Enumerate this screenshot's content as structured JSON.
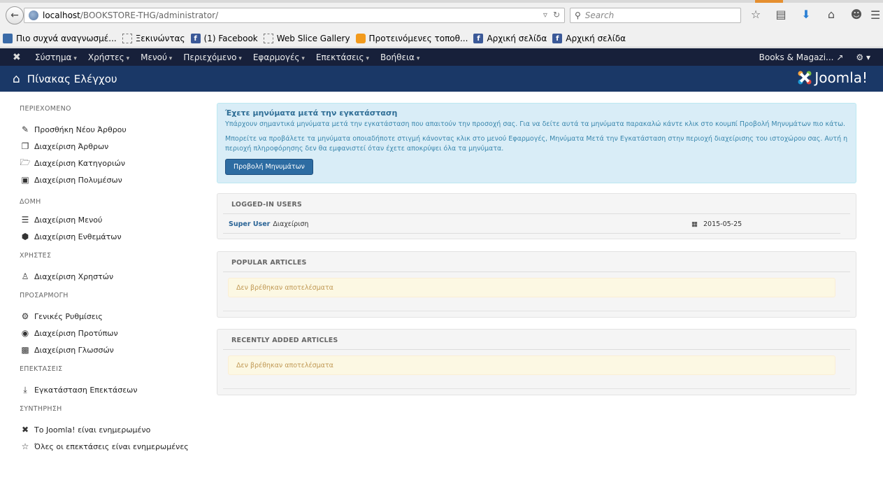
{
  "browser": {
    "url_host": "localhost",
    "url_path": "/BOOKSTORE-THG/administrator/",
    "search_placeholder": "Search",
    "bookmarks": [
      {
        "label": "Πιο συχνά αναγνωσμέ...",
        "icon": "folder-icon"
      },
      {
        "label": "Ξεκινώντας",
        "icon": "page-icon"
      },
      {
        "label": "(1) Facebook",
        "icon": "facebook-icon"
      },
      {
        "label": "Web Slice Gallery",
        "icon": "page-icon"
      },
      {
        "label": "Προτεινόμενες τοποθ...",
        "icon": "bulb-icon"
      },
      {
        "label": "Αρχική σελίδα",
        "icon": "facebook-icon"
      },
      {
        "label": "Αρχική σελίδα",
        "icon": "facebook-icon"
      }
    ]
  },
  "nav": {
    "menu": [
      "Σύστημα",
      "Χρήστες",
      "Μενού",
      "Περιεχόμενο",
      "Εφαρμογές",
      "Επεκτάσεις",
      "Βοήθεια"
    ],
    "site_link": "Books & Magazi..."
  },
  "header": {
    "title": "Πίνακας Ελέγχου",
    "brand": "Joomla!"
  },
  "sidebar": {
    "sections": [
      {
        "title": "ΠΕΡΙΕΧΟΜΕΝΟ",
        "items": [
          {
            "label": "Προσθήκη Νέου Άρθρου",
            "icon": "pencil-icon"
          },
          {
            "label": "Διαχείριση Άρθρων",
            "icon": "copy-icon"
          },
          {
            "label": "Διαχείριση Κατηγοριών",
            "icon": "folder-icon"
          },
          {
            "label": "Διαχείριση Πολυμέσων",
            "icon": "image-icon"
          }
        ]
      },
      {
        "title": "ΔΟΜΗ",
        "items": [
          {
            "label": "Διαχείριση Μενού",
            "icon": "list-icon"
          },
          {
            "label": "Διαχείριση Ενθεμάτων",
            "icon": "cube-icon"
          }
        ]
      },
      {
        "title": "ΧΡΗΣΤΕΣ",
        "items": [
          {
            "label": "Διαχείριση Χρηστών",
            "icon": "users-icon"
          }
        ]
      },
      {
        "title": "ΠΡΟΣΑΡΜΟΓΗ",
        "items": [
          {
            "label": "Γενικές Ρυθμίσεις",
            "icon": "gear-icon"
          },
          {
            "label": "Διαχείριση Προτύπων",
            "icon": "eye-icon"
          },
          {
            "label": "Διαχείριση Γλωσσών",
            "icon": "comments-icon"
          }
        ]
      },
      {
        "title": "ΕΠΕΚΤΑΣΕΙΣ",
        "items": [
          {
            "label": "Εγκατάσταση Επεκτάσεων",
            "icon": "download-icon"
          }
        ]
      },
      {
        "title": "ΣΥΝΤΗΡΗΣΗ",
        "items": [
          {
            "label": "Το Joomla! είναι ενημερωμένο",
            "icon": "joomla-icon"
          },
          {
            "label": "Όλες οι επεκτάσεις είναι ενημερωμένες",
            "icon": "star-icon"
          }
        ]
      }
    ]
  },
  "alert": {
    "title": "Έχετε μηνύματα μετά την εγκατάσταση",
    "text1": "Υπάρχουν σημαντικά μηνύματα μετά την εγκατάσταση που απαιτούν την προσοχή σας. Για να δείτε αυτά τα μηνύματα παρακαλώ κάντε κλικ στο κουμπί Προβολή Μηνυμάτων πιο κάτω.",
    "text2": "Μπορείτε να προβάλετε τα μηνύματα οποιαδήποτε στιγμή κάνοντας κλικ στο μενού Εφαρμογές, Μηνύματα Μετά την Εγκατάσταση στην περιοχή διαχείρισης του ιστοχώρου σας. Αυτή η περιοχή πληροφόρησης δεν θα εμφανιστεί όταν έχετε αποκρύψει όλα τα μηνύματα.",
    "button": "Προβολή Μηνυμάτων"
  },
  "logged_in": {
    "title": "LOGGED-IN USERS",
    "user": "Super User",
    "role": "Διαχείριση",
    "date": "2015-05-25"
  },
  "popular": {
    "title": "POPULAR ARTICLES",
    "empty": "Δεν βρέθηκαν αποτελέσματα"
  },
  "recent": {
    "title": "RECENTLY ADDED ARTICLES",
    "empty": "Δεν βρέθηκαν αποτελέσματα"
  }
}
